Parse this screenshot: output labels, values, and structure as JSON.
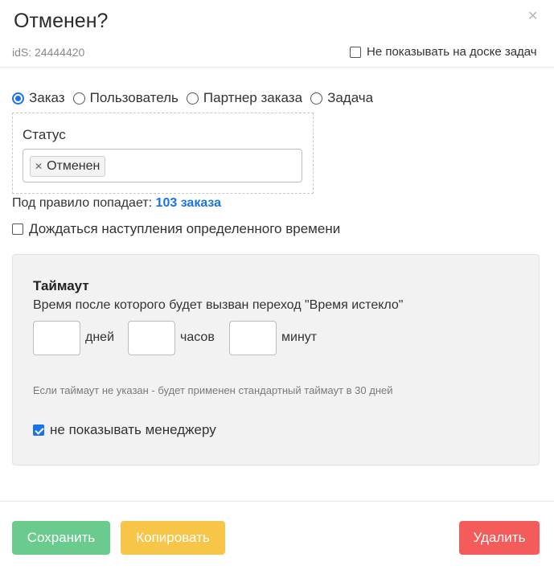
{
  "header": {
    "title": "Отменен?",
    "ids_label": "idS: 24444420",
    "hide_board_label": "Не показывать на доске задач"
  },
  "scope": {
    "options": [
      {
        "label": "Заказ",
        "checked": true
      },
      {
        "label": "Пользователь",
        "checked": false
      },
      {
        "label": "Партнер заказа",
        "checked": false
      },
      {
        "label": "Задача",
        "checked": false
      }
    ]
  },
  "status": {
    "label": "Статус",
    "selected_tag": "Отменен"
  },
  "rule": {
    "prefix": "Под правило попадает:",
    "count_text": "103 заказа"
  },
  "wait": {
    "label": "Дождаться наступления определенного времени",
    "checked": false
  },
  "timeout": {
    "title": "Таймаут",
    "description": "Время после которого будет вызван переход \"Время истекло\"",
    "days_label": "дней",
    "hours_label": "часов",
    "minutes_label": "минут",
    "days_value": "",
    "hours_value": "",
    "minutes_value": "",
    "hint": "Если таймаут не указан - будет применен стандартный таймаут в 30 дней",
    "hide_manager_label": "не показывать менеджеру",
    "hide_manager_checked": true
  },
  "buttons": {
    "save": "Сохранить",
    "copy": "Копировать",
    "delete": "Удалить"
  },
  "colors": {
    "accent": "#1a73e8",
    "save": "#6bcb8f",
    "copy": "#f7c548",
    "delete": "#f45b5b"
  }
}
